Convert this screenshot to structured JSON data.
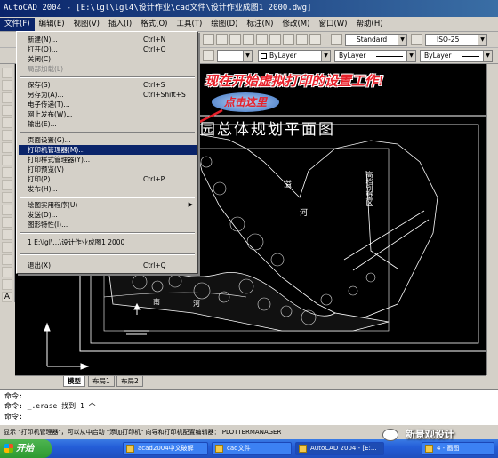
{
  "window": {
    "title": "AutoCAD 2004 - [E:\\lgl\\lgl4\\设计作业\\cad文件\\设计作业成图1 2000.dwg]"
  },
  "menubar": {
    "items": [
      "文件(F)",
      "编辑(E)",
      "视图(V)",
      "插入(I)",
      "格式(O)",
      "工具(T)",
      "绘图(D)",
      "标注(N)",
      "修改(M)",
      "窗口(W)",
      "帮助(H)"
    ]
  },
  "toolbar": {
    "text_style": "Standard",
    "dim_style": "ISO-25",
    "layer_value": "ByLayer",
    "color_value": "ByLayer",
    "linetype_value": "ByLayer",
    "lineweight_value": "ByLayer"
  },
  "file_menu": {
    "items": [
      {
        "label": "新建(N)...",
        "shortcut": "Ctrl+N"
      },
      {
        "label": "打开(O)...",
        "shortcut": "Ctrl+O"
      },
      {
        "label": "关闭(C)",
        "shortcut": ""
      },
      {
        "label": "局部加载(L)",
        "shortcut": "",
        "disabled": true
      },
      {
        "label": "保存(S)",
        "shortcut": "Ctrl+S"
      },
      {
        "label": "另存为(A)...",
        "shortcut": "Ctrl+Shift+S"
      },
      {
        "label": "电子传递(T)...",
        "shortcut": ""
      },
      {
        "label": "网上发布(W)...",
        "shortcut": ""
      },
      {
        "label": "输出(E)...",
        "shortcut": ""
      },
      {
        "label": "页面设置(G)...",
        "shortcut": ""
      },
      {
        "label": "打印机管理器(M)...",
        "shortcut": "",
        "highlighted": true
      },
      {
        "label": "打印样式管理器(Y)...",
        "shortcut": ""
      },
      {
        "label": "打印预览(V)",
        "shortcut": ""
      },
      {
        "label": "打印(P)...",
        "shortcut": "Ctrl+P"
      },
      {
        "label": "发布(H)...",
        "shortcut": ""
      },
      {
        "label": "绘图实用程序(U)",
        "shortcut": "",
        "submenu": true
      },
      {
        "label": "发送(D)...",
        "shortcut": ""
      },
      {
        "label": "图形特性(I)...",
        "shortcut": ""
      },
      {
        "label": "1 E:\\lgl\\...\\设计作业成图1 2000",
        "shortcut": ""
      },
      {
        "label": "退出(X)",
        "shortcut": "Ctrl+Q"
      }
    ]
  },
  "annotations": {
    "caption": "现在开始虚拟打印的设置工作!",
    "callout": "点击这里"
  },
  "drawing": {
    "title": "园总体规划平面图",
    "labels": [
      "高档别墅区",
      "溢",
      "河",
      "南",
      "河"
    ]
  },
  "layout_tabs": [
    "模型",
    "布局1",
    "布局2"
  ],
  "command_lines": [
    "命令:",
    "命令: _.erase 找到 1 个",
    "命令:"
  ],
  "status_text": "显示 \"打印机管理器\"，可以从中启动 \"添加打印机\" 向导和打印机配置编辑器： PLOTTERMANAGER",
  "taskbar": {
    "start_label": "开始",
    "tasks": [
      "acad2004中文破解",
      "cad文件",
      "AutoCAD 2004 - [E:...",
      "4 - 画图"
    ]
  },
  "watermark": "新景观设计",
  "colors": {
    "caption": "#e8202a",
    "highlight": "#0a246a",
    "canvas": "#000000"
  }
}
